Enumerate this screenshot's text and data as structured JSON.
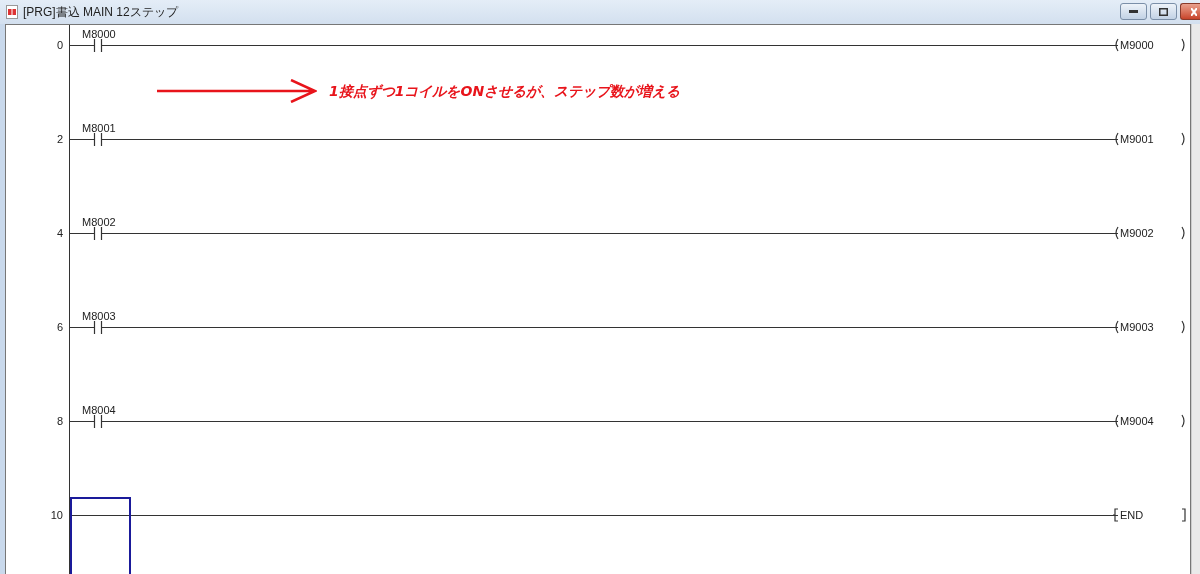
{
  "window": {
    "title": "[PRG]書込 MAIN 12ステップ"
  },
  "annotation": {
    "text": "1接点ずつ1コイルをONさせるが、ステップ数が増える"
  },
  "rungs": [
    {
      "step": "0",
      "kind": "coil",
      "contact": "M8000",
      "output": "M9000",
      "selected": false
    },
    {
      "step": "2",
      "kind": "coil",
      "contact": "M8001",
      "output": "M9001",
      "selected": false
    },
    {
      "step": "4",
      "kind": "coil",
      "contact": "M8002",
      "output": "M9002",
      "selected": false
    },
    {
      "step": "6",
      "kind": "coil",
      "contact": "M8003",
      "output": "M9003",
      "selected": false
    },
    {
      "step": "8",
      "kind": "coil",
      "contact": "M8004",
      "output": "M9004",
      "selected": false
    },
    {
      "step": "10",
      "kind": "end",
      "output": "END",
      "selected": true
    }
  ]
}
